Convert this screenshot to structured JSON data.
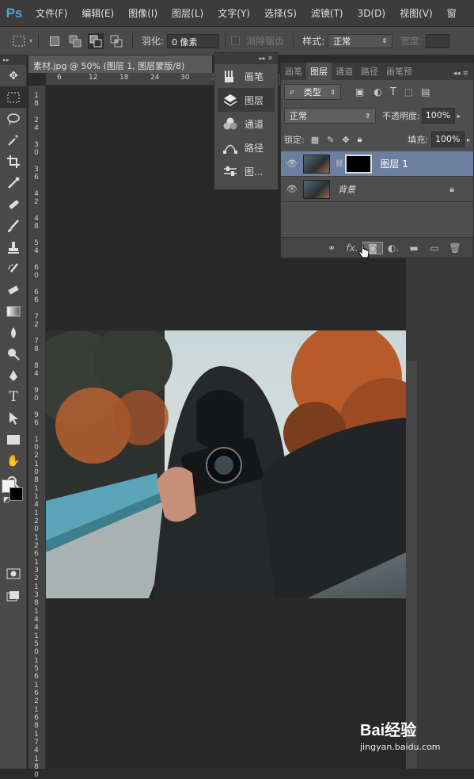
{
  "app": {
    "logo": "Ps"
  },
  "menu": [
    "文件(F)",
    "编辑(E)",
    "图像(I)",
    "图层(L)",
    "文字(Y)",
    "选择(S)",
    "滤镜(T)",
    "3D(D)",
    "视图(V)",
    "窗"
  ],
  "options": {
    "feather_label": "羽化:",
    "feather_value": "0 像素",
    "antialias_label": "消除锯齿",
    "style_label": "样式:",
    "style_value": "正常",
    "width_label": "宽度:"
  },
  "document": {
    "tab_title": "素材.jpg @ 50% (图层 1, 图层蒙版/8)",
    "hruler": [
      "6",
      "12",
      "18",
      "24",
      "30",
      "3"
    ],
    "vruler": [
      "1\n8",
      "2\n4",
      "3\n0",
      "3\n6",
      "4\n2",
      "4\n8",
      "5\n4",
      "6\n0",
      "6\n6",
      "7\n2",
      "7\n8",
      "8\n4",
      "9\n0",
      "9\n6",
      "1\n0\n2",
      "1\n0\n8",
      "1\n1\n4",
      "1\n2\n0",
      "1\n2\n6",
      "1\n3\n2",
      "1\n3\n8",
      "1\n4\n4",
      "1\n5\n0",
      "1\n5\n6",
      "1\n6\n2",
      "1\n6\n8",
      "1\n7\n4",
      "1\n8\n0"
    ]
  },
  "dock": {
    "items": [
      {
        "label": "画笔",
        "icon": "brush-icon"
      },
      {
        "label": "图层",
        "icon": "layers-icon"
      },
      {
        "label": "通道",
        "icon": "channels-icon"
      },
      {
        "label": "路径",
        "icon": "paths-icon"
      },
      {
        "label": "图...",
        "icon": "adjust-icon"
      }
    ]
  },
  "layers_panel": {
    "tabs": [
      "画笔",
      "图层",
      "通道",
      "路径",
      "画笔预"
    ],
    "active_tab": "图层",
    "filter_label": "类型",
    "blend_mode": "正常",
    "opacity_label": "不透明度:",
    "opacity_value": "100%",
    "lock_label": "锁定:",
    "fill_label": "填充:",
    "fill_value": "100%",
    "layers": [
      {
        "name": "图层 1",
        "selected": true,
        "has_mask": true
      },
      {
        "name": "背景",
        "selected": false,
        "locked": true
      }
    ]
  },
  "watermark": {
    "brand": "Bai经验",
    "url": "jingyan.baidu.com"
  }
}
